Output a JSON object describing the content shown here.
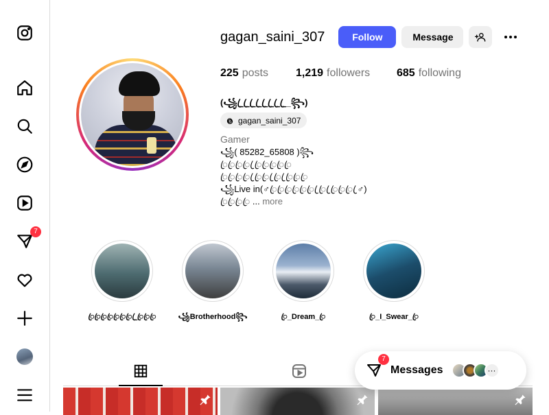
{
  "sidebar": {
    "items": [
      {
        "name": "instagram-logo-icon"
      },
      {
        "name": "home-icon"
      },
      {
        "name": "search-icon"
      },
      {
        "name": "explore-icon"
      },
      {
        "name": "reels-icon"
      },
      {
        "name": "messages-icon",
        "badge": "7"
      },
      {
        "name": "notifications-icon"
      },
      {
        "name": "create-icon"
      },
      {
        "name": "profile-avatar"
      },
      {
        "name": "menu-icon"
      }
    ]
  },
  "profile": {
    "username": "gagan_saini_307",
    "follow_label": "Follow",
    "message_label": "Message",
    "stats": {
      "posts_count": "225",
      "posts_label": "posts",
      "followers_count": "1,219",
      "followers_label": "followers",
      "following_count": "685",
      "following_label": "following"
    },
    "full_name": "(꧁_ꦿ_ꦿ_ꦿ_ꦿ_ꦿ_ꦿ_ꦿ_ꦿ_꧂)",
    "threads_handle": "gagan_saini_307",
    "category": "Gamer",
    "bio_lines": [
      "꧁( 85282_65808 )꧂",
      "ꦿꦿꦿꦿ ꦿꦿꦿꦿꦿꦿ",
      "ꦿꦿꦿꦿ ꦿꦿꦿ ꦿꦿ ꦿꦿꦿꦿ",
      "꧁Live in(♂ꦿꦿꦿꦿꦿꦿ ꦿꦿ ꦿꦿꦿꦿ ꦿ♂)",
      "ꦿꦿꦿꦿ ..."
    ],
    "bio_more": "more"
  },
  "highlights": [
    {
      "label": "ꦿꦿꦿꦿꦿꦿꦿ_ꦿꦿꦿꦿ"
    },
    {
      "label": "꧁Brotherhood꧂"
    },
    {
      "label": "ꦿ_Dream_ꦿ"
    },
    {
      "label": "ꦿ_I_Swear_ꦿ"
    }
  ],
  "tabs": [
    {
      "name": "posts-tab",
      "icon": "grid-icon",
      "active": true
    },
    {
      "name": "reels-tab",
      "icon": "reels-icon",
      "active": false
    },
    {
      "name": "tagged-tab",
      "icon": "tagged-icon",
      "active": false
    }
  ],
  "messages_bar": {
    "label": "Messages",
    "badge": "7",
    "more_avatars": "···"
  },
  "colors": {
    "follow_button": "#4a5df9",
    "badge": "#ff3040",
    "secondary_button": "#efefef"
  }
}
